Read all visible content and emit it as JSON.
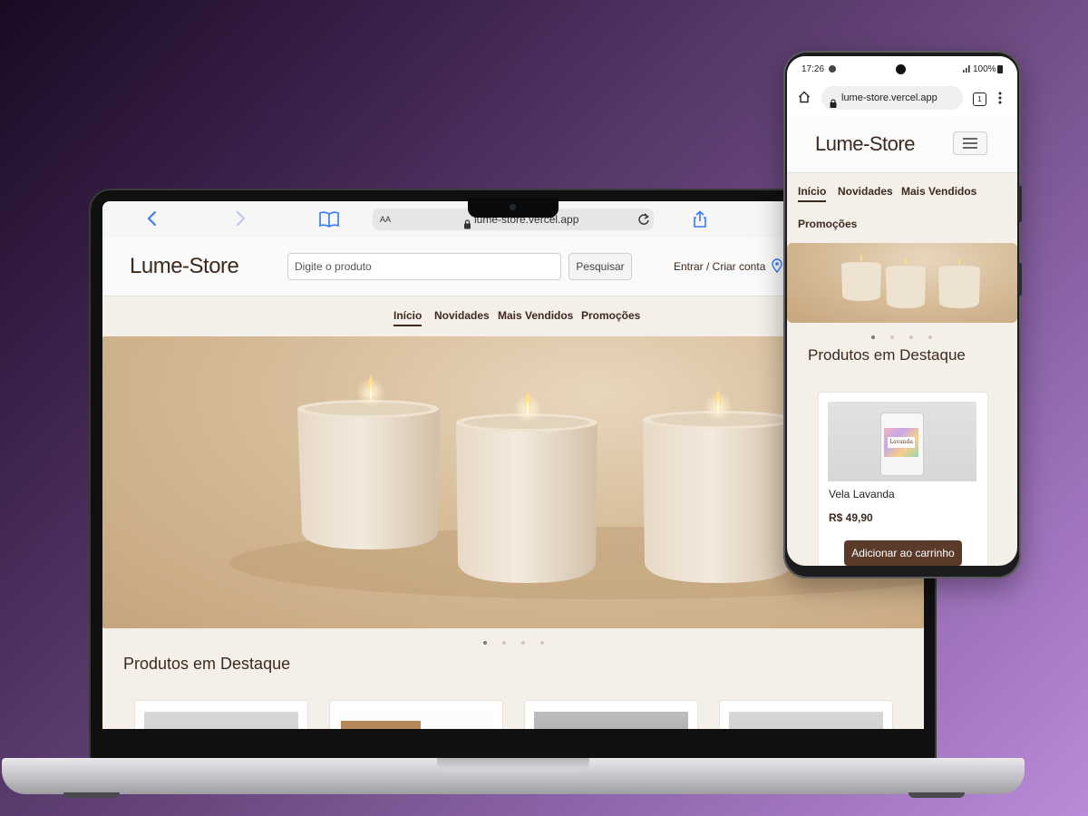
{
  "laptop": {
    "browser": {
      "url_text": "lume-store.vercel.app",
      "text_size_label": "AA",
      "icons": [
        "chevron-left-icon",
        "chevron-right-icon",
        "book-icon",
        "lock-icon",
        "reload-icon",
        "share-icon"
      ]
    },
    "site": {
      "logo": "Lume-Store",
      "search_placeholder": "Digite o produto",
      "search_button": "Pesquisar",
      "account_link": "Entrar / Criar conta",
      "nav": [
        {
          "label": "Início",
          "active": true
        },
        {
          "label": "Novidades"
        },
        {
          "label": "Mais Vendidos"
        },
        {
          "label": "Promoções"
        }
      ],
      "carousel": {
        "slides": 4,
        "active": 1
      },
      "featured_title": "Produtos em Destaque"
    }
  },
  "phone": {
    "status": {
      "time": "17:26",
      "signal_battery": "100%"
    },
    "browser": {
      "url_text": "lume-store.vercel.app",
      "tab_count": "1"
    },
    "site": {
      "logo": "Lume-Store",
      "nav": [
        {
          "label": "Início",
          "active": true
        },
        {
          "label": "Novidades"
        },
        {
          "label": "Mais Vendidos"
        },
        {
          "label": "Promoções"
        }
      ],
      "carousel": {
        "slides": 4,
        "active": 1
      },
      "featured_title": "Produtos em Destaque",
      "product": {
        "name": "Vela Lavanda",
        "price": "R$ 49,90",
        "jar_label": "Lavanda",
        "add_button": "Adicionar ao carrinho"
      }
    }
  },
  "colors": {
    "brand_brown": "#3d2a1e",
    "button_brown": "#5a3b2a",
    "page_cream": "#f4efe9",
    "safari_blue": "#3478f6"
  }
}
